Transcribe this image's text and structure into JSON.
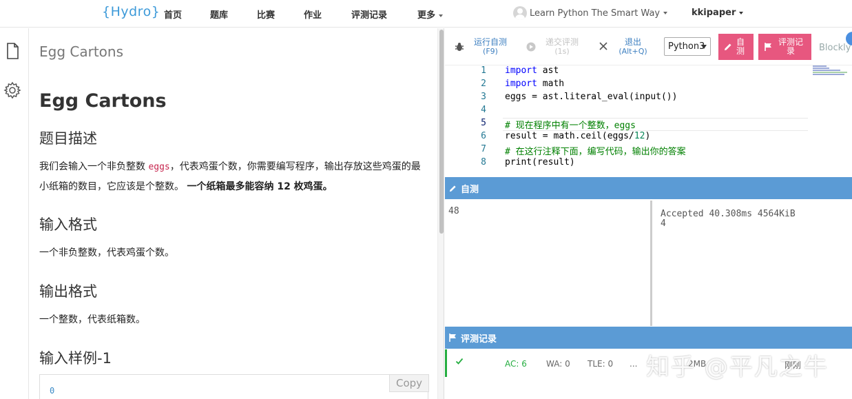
{
  "nav": {
    "logo": "{Hydro}",
    "links": [
      "首页",
      "题库",
      "比赛",
      "作业",
      "评测记录"
    ],
    "more": "更多",
    "user_domain": "Learn Python The Smart Way",
    "username": "kkipaper"
  },
  "problem": {
    "header_title": "Egg Cartons",
    "title": "Egg Cartons",
    "desc_heading": "题目描述",
    "desc_part1": "我们会输入一个非负整数 ",
    "desc_code": "eggs",
    "desc_part2": "，代表鸡蛋个数，你需要编写程序，输出存放这些鸡蛋的最小纸箱的数目，它应该是个整数。",
    "desc_bold": "一个纸箱最多能容纳 12 枚鸡蛋。",
    "input_heading": "输入格式",
    "input_text": "一个非负整数，代表鸡蛋个数。",
    "output_heading": "输出格式",
    "output_text": "一个整数，代表纸箱数。",
    "sample_heading": "输入样例-1",
    "sample_value": "0",
    "copy_label": "Copy"
  },
  "toolbar": {
    "run_label": "运行自测",
    "run_key": "(F9)",
    "submit_label": "递交评测",
    "submit_key": "(1s)",
    "exit_label": "退出",
    "exit_key": "(Alt+Q)",
    "language": "Python3",
    "selftest_btn": "自\n测",
    "records_btn": "评测记\n录",
    "blockly": "Blockly"
  },
  "editor": {
    "lines": [
      {
        "n": "1",
        "text": "import ast"
      },
      {
        "n": "2",
        "text": "import math"
      },
      {
        "n": "3",
        "text": "eggs = ast.literal_eval(input())"
      },
      {
        "n": "4",
        "text": ""
      },
      {
        "n": "5",
        "text": "# 现在程序中有一个整数，eggs"
      },
      {
        "n": "6",
        "text": "result = math.ceil(eggs/12)"
      },
      {
        "n": "7",
        "text": "# 在这行注释下面，编写代码，输出你的答案"
      },
      {
        "n": "8",
        "text": "print(result)"
      }
    ]
  },
  "selftest": {
    "bar_label": "自测",
    "input_value": "48",
    "result_status": "Accepted 40.308ms 4564KiB",
    "result_output": "4"
  },
  "records": {
    "bar_label": "评测记录",
    "ac": "AC: 6",
    "wa": "WA: 0",
    "tle": "TLE: 0",
    "more": "...",
    "mem": "2MB",
    "time": "刚刚"
  },
  "watermark": "知乎 @平凡之牛",
  "colors": {
    "accent_blue": "#5b9bd5",
    "pink": "#e7577f",
    "ac_green": "#25ad40"
  }
}
